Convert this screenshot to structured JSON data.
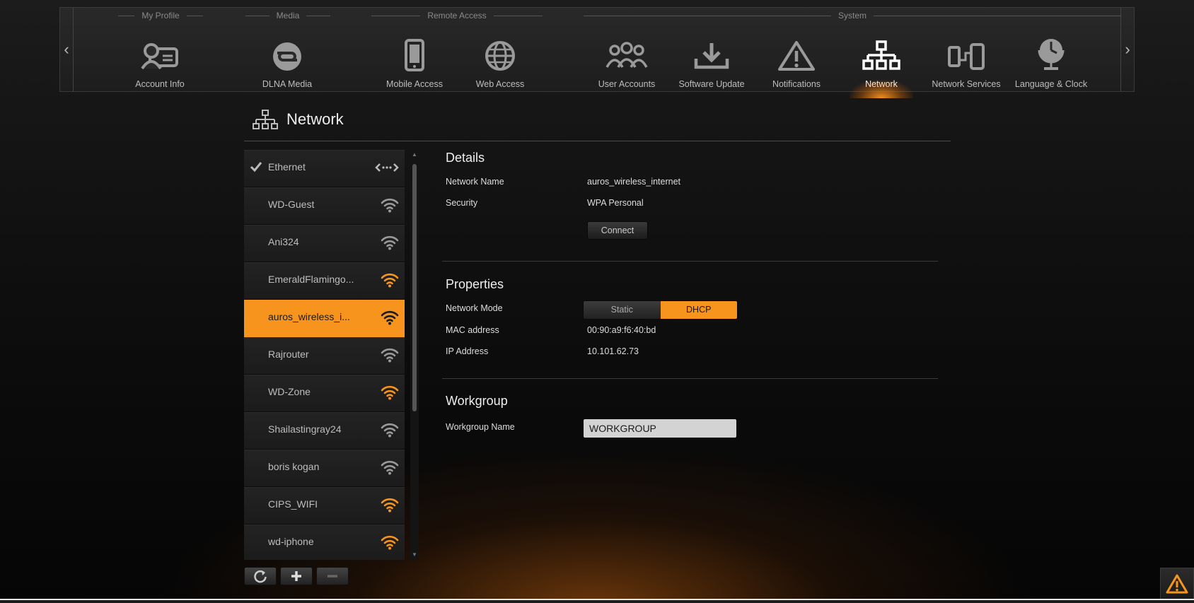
{
  "nav": {
    "groups": {
      "my_profile": "My Profile",
      "media": "Media",
      "remote_access": "Remote Access",
      "system": "System"
    },
    "items": {
      "account_info": {
        "label": "Account Info",
        "icon": "account-card-icon"
      },
      "dlna_media": {
        "label": "DLNA Media",
        "icon": "dlna-icon"
      },
      "mobile_access": {
        "label": "Mobile Access",
        "icon": "mobile-phone-icon"
      },
      "web_access": {
        "label": "Web Access",
        "icon": "globe-icon"
      },
      "user_accounts": {
        "label": "User Accounts",
        "icon": "users-icon"
      },
      "software_update": {
        "label": "Software Update",
        "icon": "download-icon"
      },
      "notifications": {
        "label": "Notifications",
        "icon": "warning-icon"
      },
      "network": {
        "label": "Network",
        "icon": "network-icon",
        "active": true
      },
      "network_services": {
        "label": "Network Services",
        "icon": "network-services-icon"
      },
      "language_clock": {
        "label": "Language & Clock",
        "icon": "globe-clock-icon"
      }
    },
    "prev_icon": "chevron-left-icon",
    "next_icon": "chevron-right-icon"
  },
  "page": {
    "title": "Network",
    "icon": "network-icon"
  },
  "networks": [
    {
      "name": "Ethernet",
      "type": "ethernet",
      "connected": true,
      "selected": false
    },
    {
      "name": "WD-Guest",
      "type": "wifi",
      "strength": "weak",
      "selected": false
    },
    {
      "name": "Ani324",
      "type": "wifi",
      "strength": "weak",
      "selected": false
    },
    {
      "name": "EmeraldFlamingo...",
      "type": "wifi",
      "strength": "strong",
      "selected": false
    },
    {
      "name": "auros_wireless_i...",
      "type": "wifi",
      "strength": "strong",
      "selected": true
    },
    {
      "name": "Rajrouter",
      "type": "wifi",
      "strength": "weak",
      "selected": false
    },
    {
      "name": "WD-Zone",
      "type": "wifi",
      "strength": "strong",
      "selected": false
    },
    {
      "name": "Shailastingray24",
      "type": "wifi",
      "strength": "weak",
      "selected": false
    },
    {
      "name": "boris kogan",
      "type": "wifi",
      "strength": "weak",
      "selected": false
    },
    {
      "name": "CIPS_WIFI",
      "type": "wifi",
      "strength": "strong",
      "selected": false
    },
    {
      "name": "wd-iphone",
      "type": "wifi",
      "strength": "strong",
      "selected": false
    }
  ],
  "list_buttons": {
    "refresh_icon": "refresh-icon",
    "add_icon": "plus-icon",
    "remove_icon": "minus-icon"
  },
  "details": {
    "title": "Details",
    "network_name_label": "Network Name",
    "network_name": "auros_wireless_internet",
    "security_label": "Security",
    "security": "WPA Personal",
    "connect_label": "Connect"
  },
  "properties": {
    "title": "Properties",
    "mode_label": "Network Mode",
    "mode_static": "Static",
    "mode_dhcp": "DHCP",
    "mode_selected": "DHCP",
    "mac_label": "MAC address",
    "mac": "00:90:a9:f6:40:bd",
    "ip_label": "IP Address",
    "ip": "10.101.62.73"
  },
  "workgroup": {
    "title": "Workgroup",
    "name_label": "Workgroup Name",
    "name_value": "WORKGROUP"
  },
  "colors": {
    "accent": "#f7941d",
    "wifi_weak": "#9a9a9a",
    "wifi_strong": "#f7941d"
  },
  "alert_icon": "warning-triangle-icon"
}
